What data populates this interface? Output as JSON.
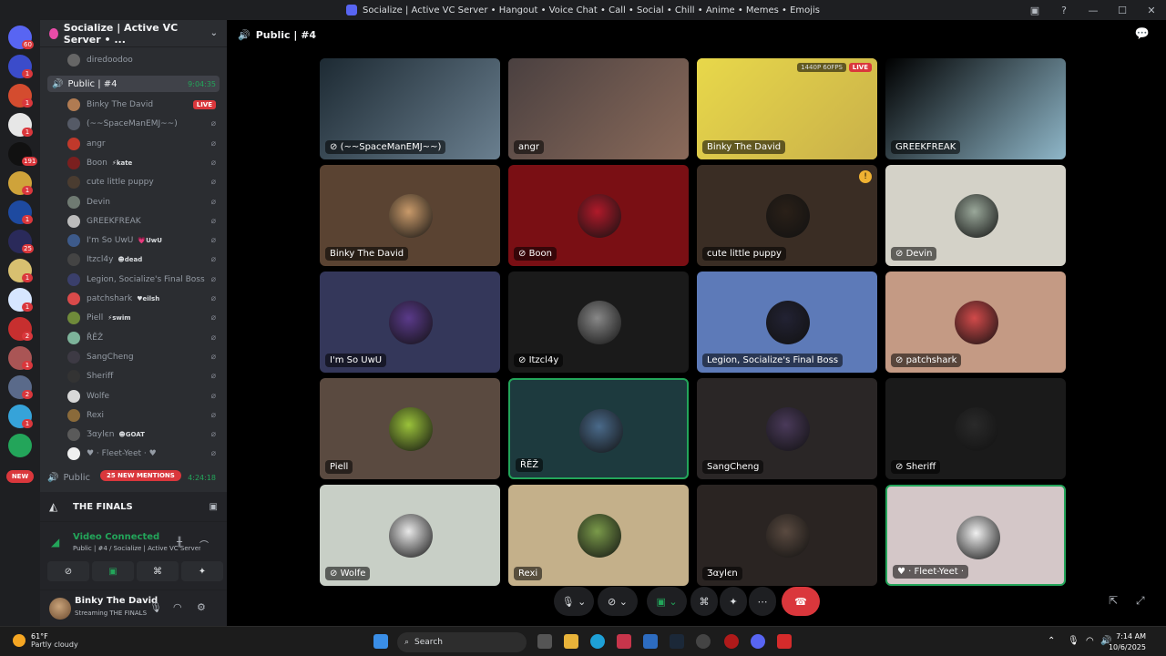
{
  "window": {
    "title": "Socialize | Active VC Server • Hangout • Voice Chat • Call • Social • Chill • Anime • Memes • Emojis"
  },
  "rail": {
    "badges": [
      "60",
      "1",
      "1",
      "1",
      "191",
      "1",
      "1",
      "25",
      "1",
      "1",
      "2",
      "1",
      "2",
      "1"
    ],
    "new_label": "NEW"
  },
  "sidebar": {
    "server_name": "Socialize | Active VC Server • ...",
    "prev_member": "diredoodoo",
    "channel": {
      "name": "Public | #4",
      "timer": "9:04:35"
    },
    "members": [
      {
        "name": "Binky The David",
        "live": "LIVE",
        "color": "#b07b52"
      },
      {
        "name": "(~~SpaceManEMJ~~)",
        "color": "#555a66"
      },
      {
        "name": "angr",
        "color": "#c0392b"
      },
      {
        "name": "Boon",
        "tag": "⚡kate",
        "color": "#7a1f1f"
      },
      {
        "name": "cute little puppy",
        "color": "#4a3c30"
      },
      {
        "name": "Devin",
        "color": "#6f7a72"
      },
      {
        "name": "GREEKFREAK",
        "color": "#bcbcbc"
      },
      {
        "name": "I'm So UwU",
        "tag": "💗UwU",
        "color": "#3d5a8a"
      },
      {
        "name": "Itzcl4y",
        "tag": "☻dead",
        "color": "#444"
      },
      {
        "name": "Legion, Socialize's Final Boss",
        "color": "#3a3f6b"
      },
      {
        "name": "patchshark",
        "tag": "♥eilsh",
        "color": "#d94a4a"
      },
      {
        "name": "Piell",
        "tag": "⚡swim",
        "color": "#6f8a3a"
      },
      {
        "name": "ŘĚŽ",
        "color": "#7db39a"
      },
      {
        "name": "SangCheng",
        "color": "#3d3a44"
      },
      {
        "name": "Sheriff",
        "color": "#333"
      },
      {
        "name": "Wolfe",
        "color": "#d8d8d8"
      },
      {
        "name": "Rexi",
        "color": "#8a6a3a"
      },
      {
        "name": "Ʒαylєn",
        "tag": "☻GOAT",
        "color": "#5a5a5a"
      },
      {
        "name": "♥ · Fleet-Yeet · ♥",
        "color": "#f0f0f0"
      }
    ],
    "next_channel": {
      "name": "Public",
      "timer": "4:24:18"
    },
    "mentions": "25 NEW MENTIONS",
    "activity": {
      "name": "THE FINALS"
    },
    "voice": {
      "status": "Video Connected",
      "sub": "Public | #4 / Socialize | Active VC Server..."
    },
    "user": {
      "name": "Binky The David",
      "status": "Streaming THE FINALS"
    }
  },
  "main": {
    "header": "Public | #4",
    "tiles": [
      {
        "name": "(~~SpaceManEMJ~~)",
        "muted": true
      },
      {
        "name": "angr"
      },
      {
        "name": "Binky The David",
        "hd": "1440P 60FPS",
        "live": "LIVE"
      },
      {
        "name": "GREEKFREAK"
      },
      {
        "name": "Binky The David"
      },
      {
        "name": "Boon",
        "muted": true
      },
      {
        "name": "cute little puppy",
        "warn": "!"
      },
      {
        "name": "Devin",
        "muted": true
      },
      {
        "name": "I'm So UwU"
      },
      {
        "name": "Itzcl4y",
        "muted": true
      },
      {
        "name": "Legion, Socialize's Final Boss"
      },
      {
        "name": "patchshark",
        "muted": true
      },
      {
        "name": "Piell"
      },
      {
        "name": "ŘĚŽ"
      },
      {
        "name": "SangCheng"
      },
      {
        "name": "Sheriff",
        "muted": true
      },
      {
        "name": "Wolfe",
        "muted": true
      },
      {
        "name": "Rexi"
      },
      {
        "name": "Ʒαylєn"
      },
      {
        "name": "♥ · Fleet-Yeet ·"
      }
    ]
  },
  "taskbar": {
    "weather_temp": "61°F",
    "weather_cond": "Partly cloudy",
    "search": "Search",
    "time": "7:14 AM",
    "date": "10/6/2025"
  }
}
